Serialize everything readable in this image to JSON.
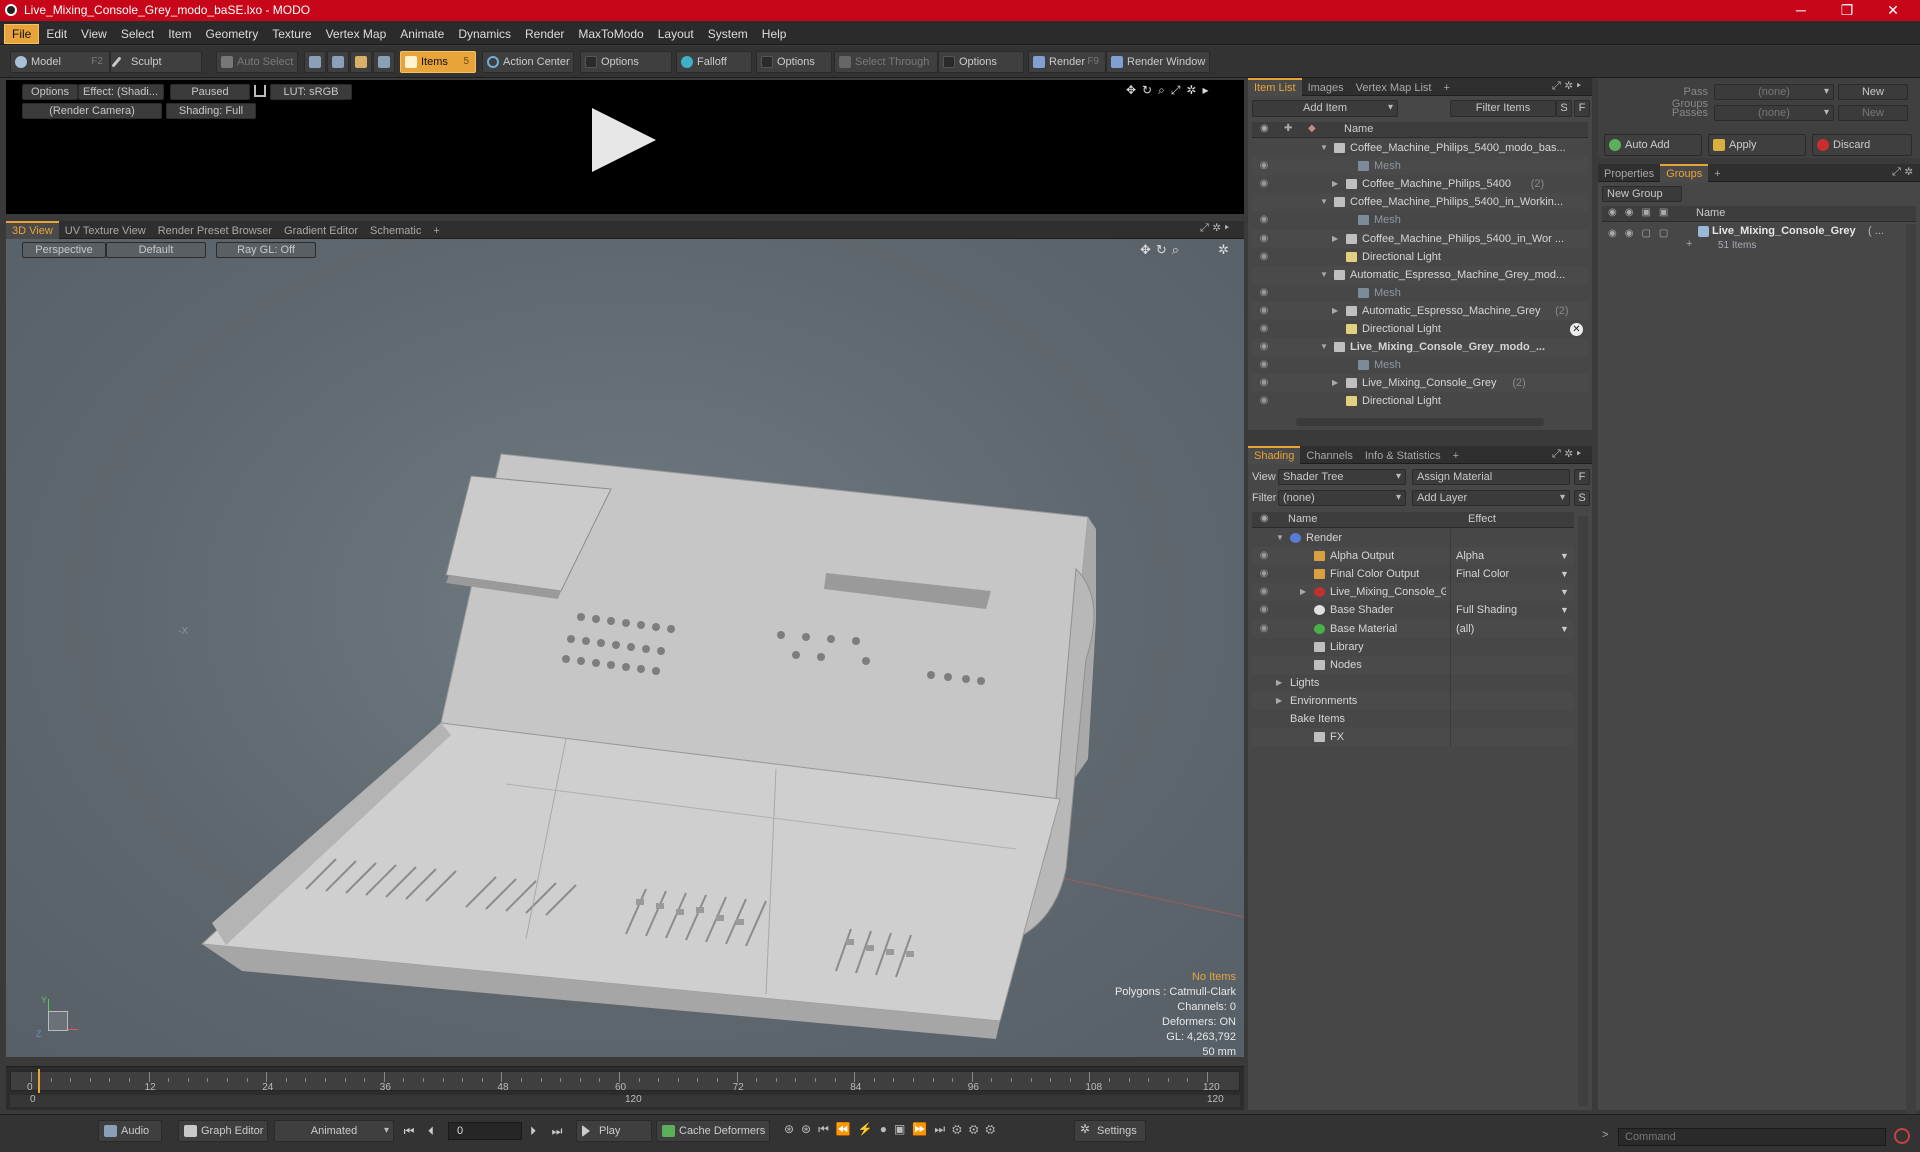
{
  "window": {
    "title": "Live_Mixing_Console_Grey_modo_baSE.lxo - MODO",
    "minimize": "─",
    "maximize": "❐",
    "close": "✕"
  },
  "menu": [
    "File",
    "Edit",
    "View",
    "Select",
    "Item",
    "Geometry",
    "Texture",
    "Vertex Map",
    "Animate",
    "Dynamics",
    "Render",
    "MaxToModo",
    "Layout",
    "System",
    "Help"
  ],
  "toolbar": {
    "model": "Model",
    "model_key": "F2",
    "sculpt": "Sculpt",
    "auto_select": "Auto Select",
    "items": "Items",
    "items_key": "5",
    "action_center": "Action Center",
    "options1": "Options",
    "falloff": "Falloff",
    "options2": "Options",
    "select_through": "Select Through",
    "options3": "Options",
    "render": "Render",
    "render_key": "F9",
    "render_window": "Render Window"
  },
  "preview": {
    "options": "Options",
    "effect": "Effect: (Shadi...",
    "paused": "Paused",
    "lut": "LUT: sRGB",
    "camera": "(Render Camera)",
    "shading": "Shading: Full",
    "play_icon": "play-icon"
  },
  "viewport_tabs": [
    "3D View",
    "UV Texture View",
    "Render Preset Browser",
    "Gradient Editor",
    "Schematic",
    "+"
  ],
  "viewport": {
    "perspective": "Perspective",
    "default": "Default",
    "raygl": "Ray GL: Off",
    "axis_x": "-X",
    "axis_y": "Y",
    "axis_z": "Z"
  },
  "stats": {
    "no_items": "No Items",
    "polygons": "Polygons : Catmull-Clark",
    "channels": "Channels: 0",
    "deformers": "Deformers: ON",
    "gl": "GL: 4,263,792",
    "scale": "50 mm"
  },
  "timeline": {
    "ticks": [
      "0",
      "12",
      "24",
      "36",
      "48",
      "60",
      "72",
      "84",
      "96",
      "108",
      "120"
    ],
    "start": "0",
    "mid": "120",
    "end": "120"
  },
  "bottom": {
    "audio": "Audio",
    "graph_editor": "Graph Editor",
    "animated": "Animated",
    "frame": "0",
    "play": "Play",
    "cache": "Cache Deformers",
    "settings": "Settings"
  },
  "item_list": {
    "tabs": [
      "Item List",
      "Images",
      "Vertex Map List",
      "+"
    ],
    "add_item": "Add Item",
    "filter_items": "Filter Items",
    "s": "S",
    "f": "F",
    "col_name": "Name",
    "rows": [
      {
        "text": "Coffee_Machine_Philips_5400_modo_bas...",
        "indent": 0,
        "arrow": "▼",
        "bold": false,
        "gray": false,
        "eye": ""
      },
      {
        "text": "Mesh",
        "indent": 2,
        "arrow": "",
        "bold": false,
        "gray": true,
        "eye": "◉"
      },
      {
        "text": "Coffee_Machine_Philips_5400",
        "suffix": "(2)",
        "indent": 1,
        "arrow": "▶",
        "bold": false,
        "gray": false,
        "eye": "◉"
      },
      {
        "text": "Coffee_Machine_Philips_5400_in_Workin...",
        "indent": 0,
        "arrow": "▼",
        "bold": false,
        "gray": false,
        "eye": ""
      },
      {
        "text": "Mesh",
        "indent": 2,
        "arrow": "",
        "bold": false,
        "gray": true,
        "eye": "◉"
      },
      {
        "text": "Coffee_Machine_Philips_5400_in_Wor ...",
        "indent": 1,
        "arrow": "▶",
        "bold": false,
        "gray": false,
        "eye": "◉"
      },
      {
        "text": "Directional Light",
        "indent": 1,
        "arrow": "",
        "bold": false,
        "gray": false,
        "eye": "◉"
      },
      {
        "text": "Automatic_Espresso_Machine_Grey_mod...",
        "indent": 0,
        "arrow": "▼",
        "bold": false,
        "gray": false,
        "eye": ""
      },
      {
        "text": "Mesh",
        "indent": 2,
        "arrow": "",
        "bold": false,
        "gray": true,
        "eye": "◉"
      },
      {
        "text": "Automatic_Espresso_Machine_Grey",
        "suffix": "(2)",
        "indent": 1,
        "arrow": "▶",
        "bold": false,
        "gray": false,
        "eye": "◉"
      },
      {
        "text": "Directional Light",
        "indent": 1,
        "arrow": "",
        "bold": false,
        "gray": false,
        "eye": "◉"
      },
      {
        "text": "Live_Mixing_Console_Grey_modo_...",
        "indent": 0,
        "arrow": "▼",
        "bold": true,
        "gray": false,
        "eye": "◉"
      },
      {
        "text": "Mesh",
        "indent": 2,
        "arrow": "",
        "bold": false,
        "gray": true,
        "eye": "◉"
      },
      {
        "text": "Live_Mixing_Console_Grey",
        "suffix": "(2)",
        "indent": 1,
        "arrow": "▶",
        "bold": false,
        "gray": false,
        "eye": "◉"
      },
      {
        "text": "Directional Light",
        "indent": 1,
        "arrow": "",
        "bold": false,
        "gray": false,
        "eye": "◉"
      }
    ]
  },
  "shading": {
    "tabs": [
      "Shading",
      "Channels",
      "Info & Statistics",
      "+"
    ],
    "view_label": "View",
    "view_value": "Shader Tree",
    "assign_material": "Assign Material",
    "filter_label": "Filter",
    "filter_value": "(none)",
    "add_layer": "Add Layer",
    "f": "F",
    "s": "S",
    "col_name": "Name",
    "col_effect": "Effect",
    "rows": [
      {
        "text": "Render",
        "effect": "",
        "indent": 0,
        "arrow": "▼",
        "eye": "",
        "color": "#5a7ad8"
      },
      {
        "text": "Alpha Output",
        "effect": "Alpha",
        "indent": 1,
        "arrow": "",
        "eye": "◉",
        "color": "#d8a040"
      },
      {
        "text": "Final Color Output",
        "effect": "Final Color",
        "indent": 1,
        "arrow": "",
        "eye": "◉",
        "color": "#d8a040"
      },
      {
        "text": "Live_Mixing_Console_Grey ...",
        "effect": "",
        "indent": 1,
        "arrow": "▶",
        "eye": "◉",
        "color": "#c03030"
      },
      {
        "text": "Base Shader",
        "effect": "Full Shading",
        "indent": 1,
        "arrow": "",
        "eye": "◉",
        "color": "#e0e0e0"
      },
      {
        "text": "Base Material",
        "effect": "(all)",
        "indent": 1,
        "arrow": "",
        "eye": "◉",
        "color": "#4ab04a"
      },
      {
        "text": "Library",
        "effect": "",
        "indent": 1,
        "arrow": "",
        "eye": "",
        "color": "#bfbfbf"
      },
      {
        "text": "Nodes",
        "effect": "",
        "indent": 1,
        "arrow": "",
        "eye": "",
        "color": "#bfbfbf"
      },
      {
        "text": "Lights",
        "effect": "",
        "indent": 0,
        "arrow": "▶",
        "eye": "",
        "color": ""
      },
      {
        "text": "Environments",
        "effect": "",
        "indent": 0,
        "arrow": "▶",
        "eye": "",
        "color": ""
      },
      {
        "text": "Bake Items",
        "effect": "",
        "indent": 0,
        "arrow": "",
        "eye": "",
        "color": ""
      },
      {
        "text": "FX",
        "effect": "",
        "indent": 1,
        "arrow": "",
        "eye": "",
        "color": "#bfbfbf"
      }
    ]
  },
  "right": {
    "pass_groups": "Pass Groups",
    "pass_groups_value": "(none)",
    "new1": "New",
    "passes": "Passes",
    "passes_value": "(none)",
    "new2": "New",
    "auto_add": "Auto Add",
    "apply": "Apply",
    "discard": "Discard",
    "tabs": [
      "Properties",
      "Groups",
      "+"
    ],
    "new_group": "New Group",
    "col_name": "Name",
    "group_name": "Live_Mixing_Console_Grey",
    "group_suffix": "( ...",
    "group_count": "51 Items",
    "command": "Command"
  }
}
